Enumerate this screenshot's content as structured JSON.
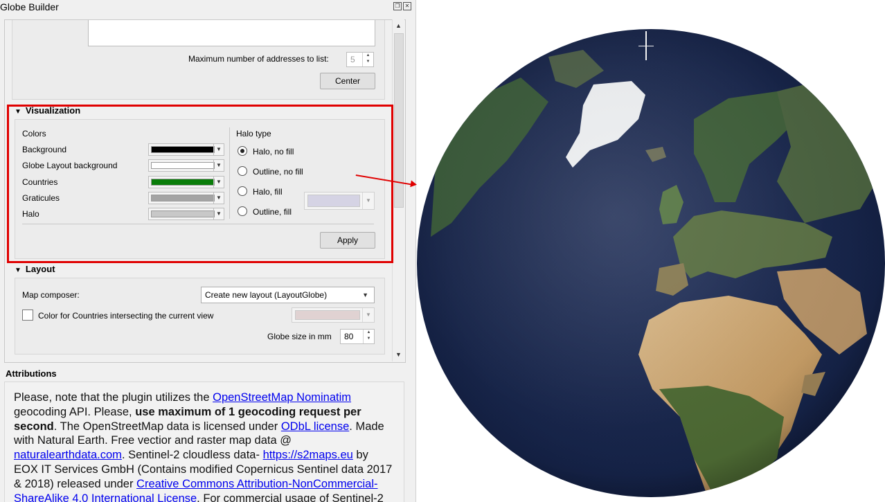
{
  "window": {
    "title": "Globe Builder",
    "float_icon": "restore-icon",
    "close_icon": "close-icon"
  },
  "geocode": {
    "max_addresses_label": "Maximum number of addresses to list:",
    "max_addresses_value": "5",
    "center_button": "Center"
  },
  "visualization": {
    "title": "Visualization",
    "colors_heading": "Colors",
    "rows": [
      {
        "label": "Background",
        "color": "#000000"
      },
      {
        "label": "Globe Layout background",
        "color": "#ffffff"
      },
      {
        "label": "Countries",
        "color": "#0a7d0a"
      },
      {
        "label": "Graticules",
        "color": "#a4a4a4"
      },
      {
        "label": "Halo",
        "color": "#c8c8c8"
      }
    ],
    "halo_heading": "Halo type",
    "halo_options": [
      {
        "label": "Halo, no fill",
        "checked": true
      },
      {
        "label": "Outline, no fill",
        "checked": false
      },
      {
        "label": "Halo, fill",
        "checked": false
      },
      {
        "label": "Outline, fill",
        "checked": false
      }
    ],
    "halo_fill_color": "#d5d3e4",
    "apply_button": "Apply"
  },
  "layout": {
    "title": "Layout",
    "map_composer_label": "Map composer:",
    "map_composer_value": "Create new layout (LayoutGlobe)",
    "color_countries_label": "Color for Countries intersecting the current view",
    "color_countries_checked": false,
    "color_countries_color": "#e0d2d2",
    "globe_size_label": "Globe size in mm",
    "globe_size_value": "80"
  },
  "attributions": {
    "title": "Attributions",
    "t1": "Please, note that the plugin utilizes the ",
    "l1": "OpenStreetMap Nominatim",
    "t2": " geocoding API. Please, ",
    "b1": "use maximum of 1 geocoding request per second",
    "t3": ". The OpenStreetMap data is licensed under ",
    "l2": "ODbL license",
    "t4": ". Made with Natural Earth. Free vectior and raster map data @ ",
    "l3": "naturalearthdata.com",
    "t5": ". Sentinel-2 cloudless data- ",
    "l4": "https://s2maps.eu",
    "t6": " by EOX IT Services GmbH (Contains modified Copernicus Sentinel data 2017 & 2018) released under ",
    "l5": "Creative Commons Attribution-NonCommercial-ShareAlike 4.0 International License",
    "t7": ". For commercial usage of Sentinel-2"
  },
  "globe": {
    "ocean_color": "#172650",
    "ice_color": "#f2f2f2"
  }
}
